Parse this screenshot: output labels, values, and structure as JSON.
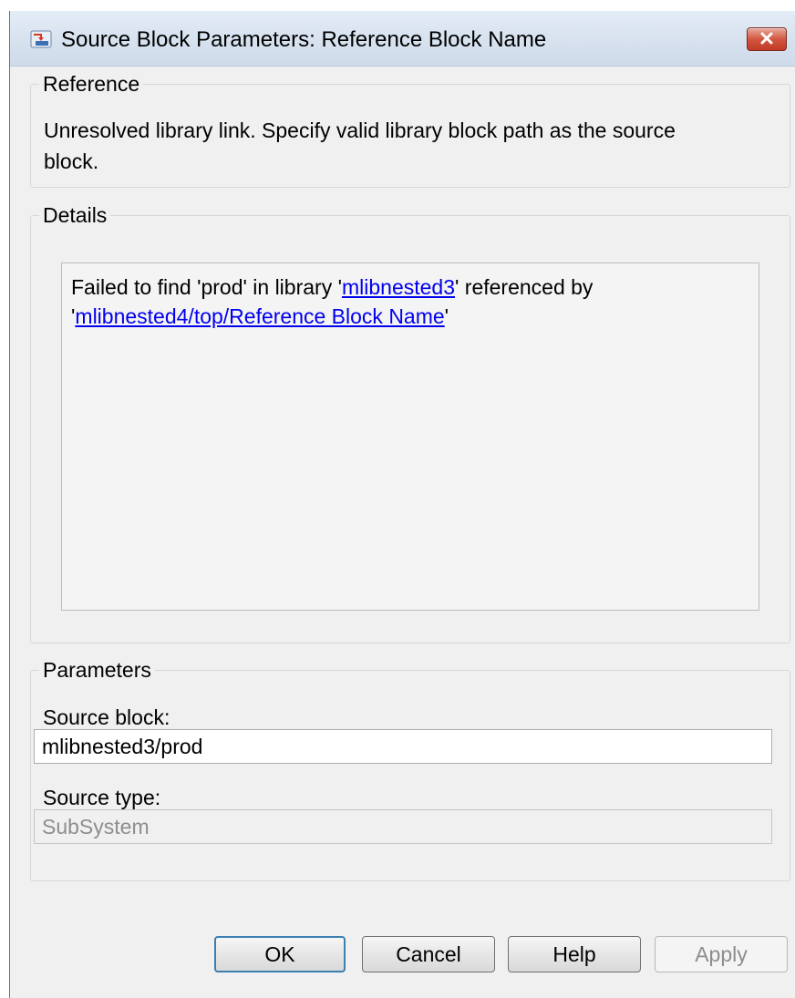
{
  "window": {
    "title": "Source Block Parameters: Reference Block Name",
    "icons": {
      "app": "simulink-block-icon",
      "close": "close-icon"
    },
    "colors": {
      "link": "#0000ee",
      "close_button": "#c94a34",
      "default_button_border": "#3c7fb1"
    }
  },
  "reference": {
    "legend": "Reference",
    "message_line1": "Unresolved library link. Specify valid library block path as the source",
    "message_line2": "block."
  },
  "details": {
    "legend": "Details",
    "prefix": "Failed to find 'prod' in library '",
    "library_link": "mlibnested3",
    "middle": "' referenced by",
    "quote_open": "'",
    "block_link": "mlibnested4/top/Reference Block Name",
    "quote_close": "'"
  },
  "parameters": {
    "legend": "Parameters",
    "source_block_label": "Source block:",
    "source_block_value": "mlibnested3/prod",
    "source_type_label": "Source type:",
    "source_type_value": "SubSystem"
  },
  "buttons": {
    "ok": "OK",
    "cancel": "Cancel",
    "help": "Help",
    "apply": "Apply"
  }
}
